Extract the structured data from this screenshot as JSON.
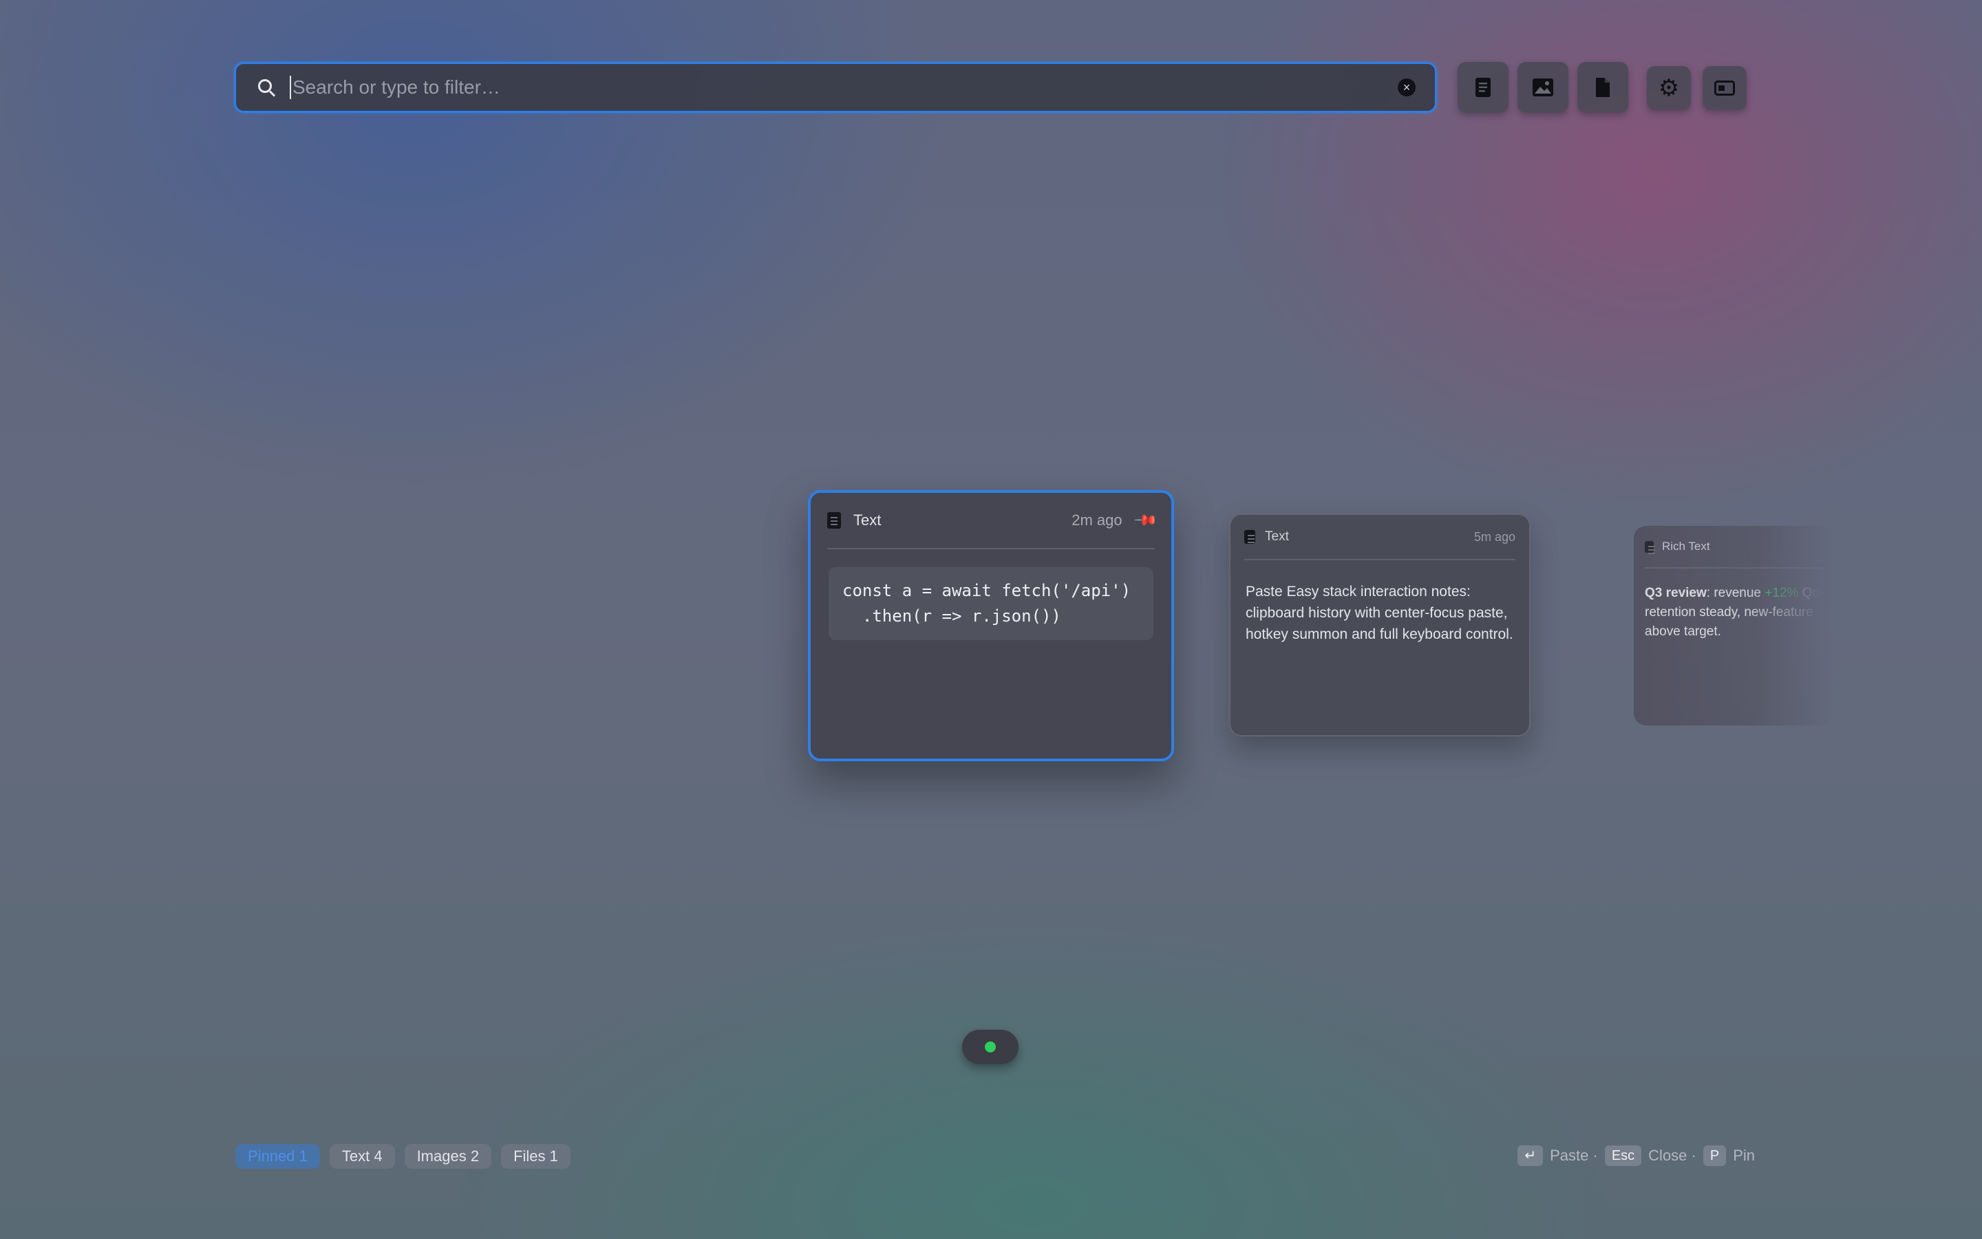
{
  "search": {
    "placeholder": "Search or type to filter…",
    "clear_icon": "clear-icon"
  },
  "toolbar": {
    "buttons": [
      {
        "name": "text-filter-button",
        "icon": "document-text-icon"
      },
      {
        "name": "image-filter-button",
        "icon": "image-icon"
      },
      {
        "name": "file-filter-button",
        "icon": "file-icon"
      },
      {
        "name": "settings-button",
        "icon": "gear-icon"
      },
      {
        "name": "window-mode-button",
        "icon": "window-icon"
      }
    ]
  },
  "cards": [
    {
      "type": "Text",
      "time": "2m ago",
      "pinned": true,
      "code_line1": "const a = await fetch('/api')",
      "code_line2": "  .then(r => r.json())"
    },
    {
      "type": "Text",
      "time": "5m ago",
      "body": "Paste Easy stack interaction notes: clipboard history with center-focus paste, hotkey summon and full keyboard control."
    },
    {
      "type": "Rich Text",
      "body_bold": "Q3 review",
      "body_pre": ": revenue ",
      "body_highlight": "+12%",
      "body_line1_rest": " QoQ,",
      "body_line2": "retention steady, new-feature",
      "body_line3": "above target."
    }
  ],
  "status": {
    "color": "#2ecf5c"
  },
  "filters": [
    {
      "label": "Pinned 1",
      "active": true
    },
    {
      "label": "Text 4",
      "active": false
    },
    {
      "label": "Images 2",
      "active": false
    },
    {
      "label": "Files 1",
      "active": false
    }
  ],
  "shortcuts": {
    "enter_key": "↵",
    "enter_label": "Paste ·",
    "esc_key": "Esc",
    "esc_label": "Close ·",
    "pin_key": "P",
    "pin_label": "Pin"
  },
  "colors": {
    "accent": "#2f7fe6",
    "highlight": "#49c27a"
  }
}
